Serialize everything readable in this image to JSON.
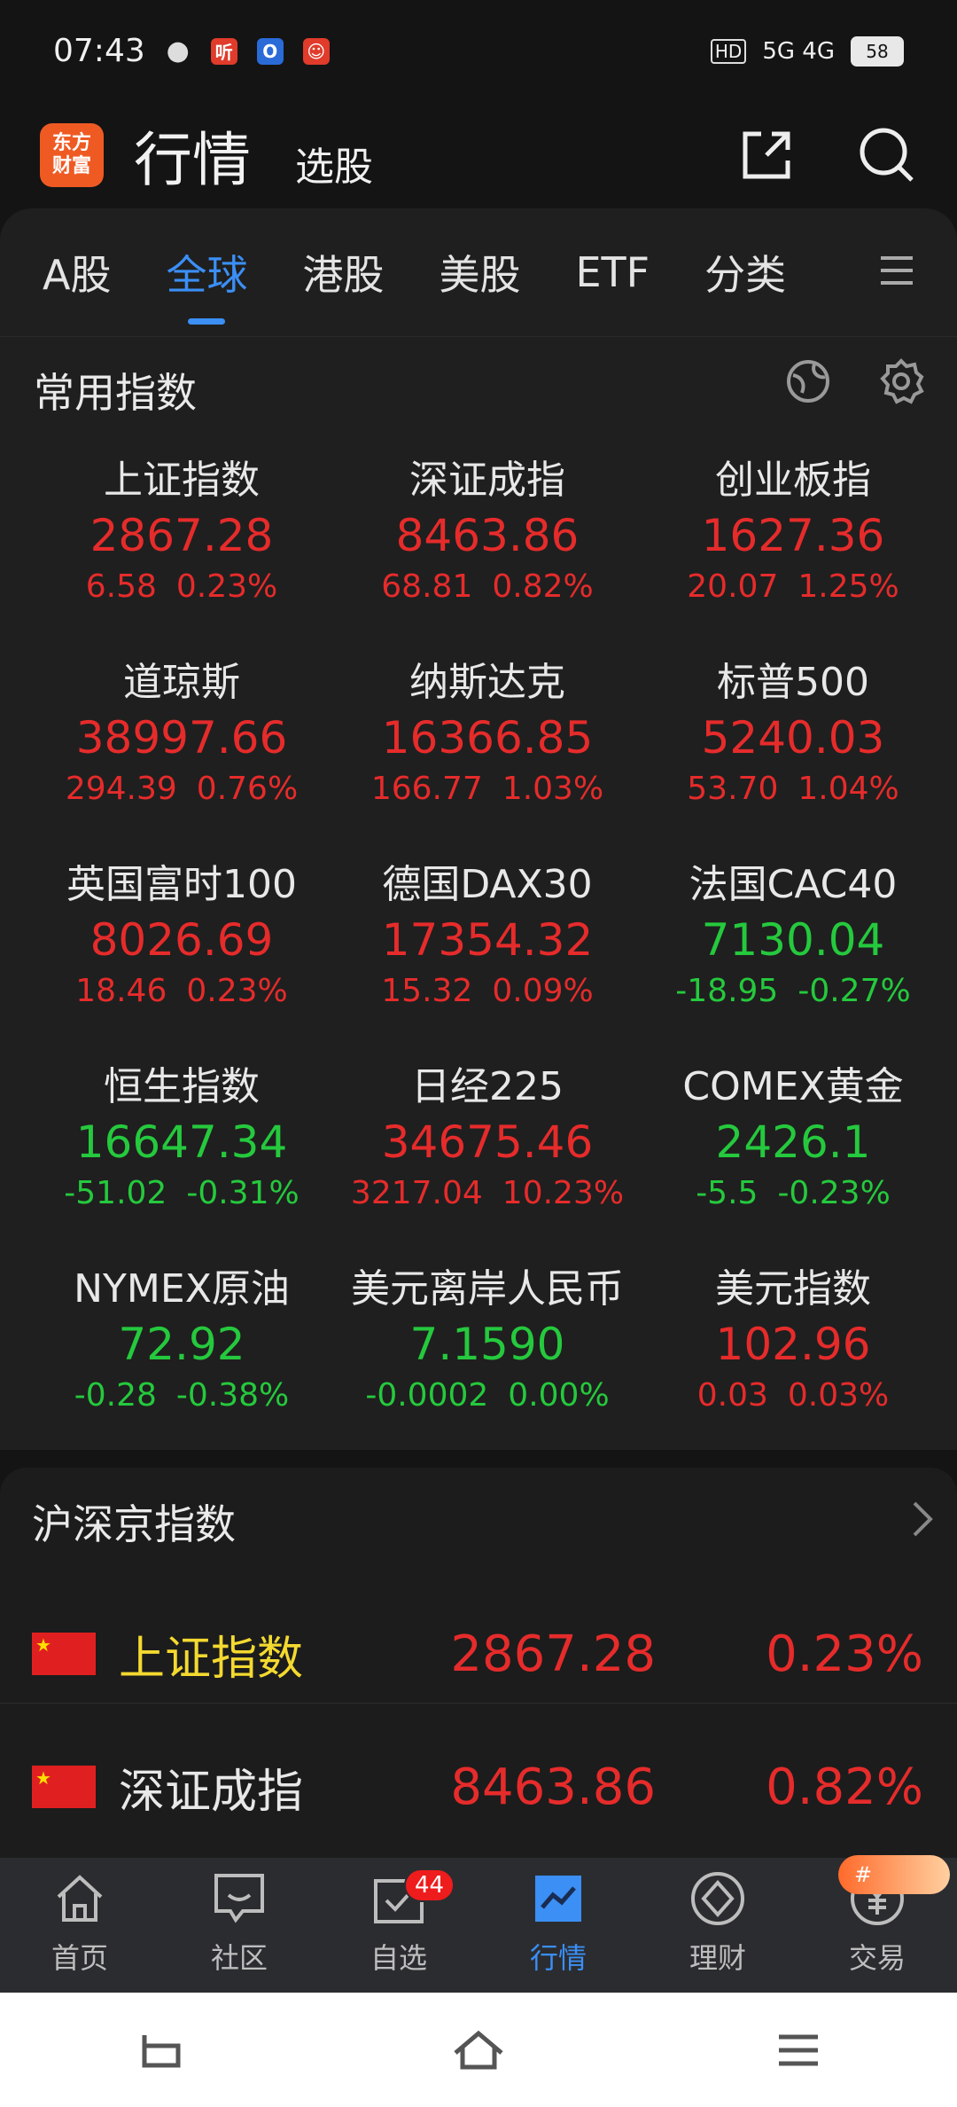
{
  "status": {
    "time": "07:43",
    "network": "5G 4G",
    "battery": "58",
    "hd": "HD",
    "app_badge": "听"
  },
  "header": {
    "logo_line1": "东方",
    "logo_line2": "财富",
    "title": "行情",
    "subtitle": "选股"
  },
  "tabs": [
    "A股",
    "全球",
    "港股",
    "美股",
    "ETF",
    "分类"
  ],
  "common_indices": {
    "title": "常用指数",
    "items": [
      {
        "name": "上证指数",
        "price": "2867.28",
        "change": "6.58",
        "pct": "0.23%",
        "dir": "up"
      },
      {
        "name": "深证成指",
        "price": "8463.86",
        "change": "68.81",
        "pct": "0.82%",
        "dir": "up"
      },
      {
        "name": "创业板指",
        "price": "1627.36",
        "change": "20.07",
        "pct": "1.25%",
        "dir": "up"
      },
      {
        "name": "道琼斯",
        "price": "38997.66",
        "change": "294.39",
        "pct": "0.76%",
        "dir": "up"
      },
      {
        "name": "纳斯达克",
        "price": "16366.85",
        "change": "166.77",
        "pct": "1.03%",
        "dir": "up"
      },
      {
        "name": "标普500",
        "price": "5240.03",
        "change": "53.70",
        "pct": "1.04%",
        "dir": "up"
      },
      {
        "name": "英国富时100",
        "price": "8026.69",
        "change": "18.46",
        "pct": "0.23%",
        "dir": "up"
      },
      {
        "name": "德国DAX30",
        "price": "17354.32",
        "change": "15.32",
        "pct": "0.09%",
        "dir": "up"
      },
      {
        "name": "法国CAC40",
        "price": "7130.04",
        "change": "-18.95",
        "pct": "-0.27%",
        "dir": "down"
      },
      {
        "name": "恒生指数",
        "price": "16647.34",
        "change": "-51.02",
        "pct": "-0.31%",
        "dir": "down"
      },
      {
        "name": "日经225",
        "price": "34675.46",
        "change": "3217.04",
        "pct": "10.23%",
        "dir": "up"
      },
      {
        "name": "COMEX黄金",
        "price": "2426.1",
        "change": "-5.5",
        "pct": "-0.23%",
        "dir": "down"
      },
      {
        "name": "NYMEX原油",
        "price": "72.92",
        "change": "-0.28",
        "pct": "-0.38%",
        "dir": "down"
      },
      {
        "name": "美元离岸人民币",
        "price": "7.1590",
        "change": "-0.0002",
        "pct": "0.00%",
        "dir": "down"
      },
      {
        "name": "美元指数",
        "price": "102.96",
        "change": "0.03",
        "pct": "0.03%",
        "dir": "up"
      }
    ]
  },
  "hs_indices": {
    "title": "沪深京指数",
    "rows": [
      {
        "name": "上证指数",
        "price": "2867.28",
        "pct": "0.23%"
      },
      {
        "name": "深证成指",
        "price": "8463.86",
        "pct": "0.82%"
      }
    ]
  },
  "bottom_nav": [
    {
      "label": "首页"
    },
    {
      "label": "社区"
    },
    {
      "label": "自选",
      "badge": "44"
    },
    {
      "label": "行情"
    },
    {
      "label": "理财"
    },
    {
      "label": "交易"
    }
  ],
  "promo_text": "#",
  "colors": {
    "up": "#e62b2b",
    "down": "#25c93d",
    "accent": "#3b8ff5",
    "highlight": "#f4d930"
  }
}
